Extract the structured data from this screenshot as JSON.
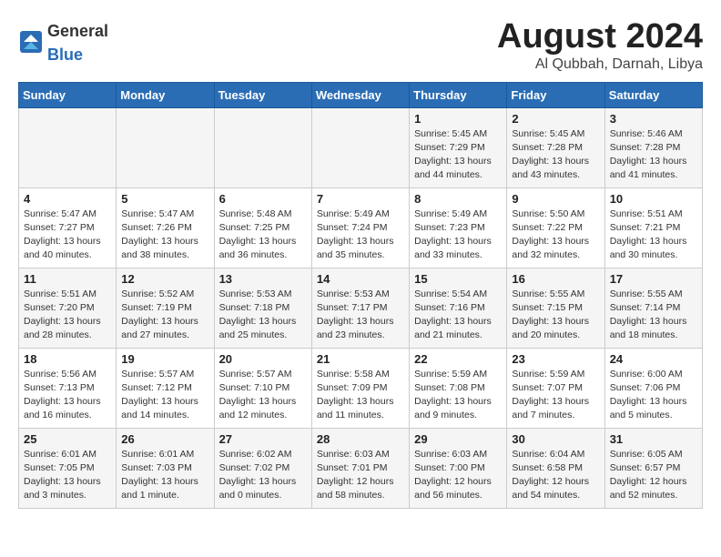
{
  "header": {
    "logo_general": "General",
    "logo_blue": "Blue",
    "month_year": "August 2024",
    "location": "Al Qubbah, Darnah, Libya"
  },
  "days_of_week": [
    "Sunday",
    "Monday",
    "Tuesday",
    "Wednesday",
    "Thursday",
    "Friday",
    "Saturday"
  ],
  "weeks": [
    [
      {
        "day": "",
        "info": ""
      },
      {
        "day": "",
        "info": ""
      },
      {
        "day": "",
        "info": ""
      },
      {
        "day": "",
        "info": ""
      },
      {
        "day": "1",
        "info": "Sunrise: 5:45 AM\nSunset: 7:29 PM\nDaylight: 13 hours\nand 44 minutes."
      },
      {
        "day": "2",
        "info": "Sunrise: 5:45 AM\nSunset: 7:28 PM\nDaylight: 13 hours\nand 43 minutes."
      },
      {
        "day": "3",
        "info": "Sunrise: 5:46 AM\nSunset: 7:28 PM\nDaylight: 13 hours\nand 41 minutes."
      }
    ],
    [
      {
        "day": "4",
        "info": "Sunrise: 5:47 AM\nSunset: 7:27 PM\nDaylight: 13 hours\nand 40 minutes."
      },
      {
        "day": "5",
        "info": "Sunrise: 5:47 AM\nSunset: 7:26 PM\nDaylight: 13 hours\nand 38 minutes."
      },
      {
        "day": "6",
        "info": "Sunrise: 5:48 AM\nSunset: 7:25 PM\nDaylight: 13 hours\nand 36 minutes."
      },
      {
        "day": "7",
        "info": "Sunrise: 5:49 AM\nSunset: 7:24 PM\nDaylight: 13 hours\nand 35 minutes."
      },
      {
        "day": "8",
        "info": "Sunrise: 5:49 AM\nSunset: 7:23 PM\nDaylight: 13 hours\nand 33 minutes."
      },
      {
        "day": "9",
        "info": "Sunrise: 5:50 AM\nSunset: 7:22 PM\nDaylight: 13 hours\nand 32 minutes."
      },
      {
        "day": "10",
        "info": "Sunrise: 5:51 AM\nSunset: 7:21 PM\nDaylight: 13 hours\nand 30 minutes."
      }
    ],
    [
      {
        "day": "11",
        "info": "Sunrise: 5:51 AM\nSunset: 7:20 PM\nDaylight: 13 hours\nand 28 minutes."
      },
      {
        "day": "12",
        "info": "Sunrise: 5:52 AM\nSunset: 7:19 PM\nDaylight: 13 hours\nand 27 minutes."
      },
      {
        "day": "13",
        "info": "Sunrise: 5:53 AM\nSunset: 7:18 PM\nDaylight: 13 hours\nand 25 minutes."
      },
      {
        "day": "14",
        "info": "Sunrise: 5:53 AM\nSunset: 7:17 PM\nDaylight: 13 hours\nand 23 minutes."
      },
      {
        "day": "15",
        "info": "Sunrise: 5:54 AM\nSunset: 7:16 PM\nDaylight: 13 hours\nand 21 minutes."
      },
      {
        "day": "16",
        "info": "Sunrise: 5:55 AM\nSunset: 7:15 PM\nDaylight: 13 hours\nand 20 minutes."
      },
      {
        "day": "17",
        "info": "Sunrise: 5:55 AM\nSunset: 7:14 PM\nDaylight: 13 hours\nand 18 minutes."
      }
    ],
    [
      {
        "day": "18",
        "info": "Sunrise: 5:56 AM\nSunset: 7:13 PM\nDaylight: 13 hours\nand 16 minutes."
      },
      {
        "day": "19",
        "info": "Sunrise: 5:57 AM\nSunset: 7:12 PM\nDaylight: 13 hours\nand 14 minutes."
      },
      {
        "day": "20",
        "info": "Sunrise: 5:57 AM\nSunset: 7:10 PM\nDaylight: 13 hours\nand 12 minutes."
      },
      {
        "day": "21",
        "info": "Sunrise: 5:58 AM\nSunset: 7:09 PM\nDaylight: 13 hours\nand 11 minutes."
      },
      {
        "day": "22",
        "info": "Sunrise: 5:59 AM\nSunset: 7:08 PM\nDaylight: 13 hours\nand 9 minutes."
      },
      {
        "day": "23",
        "info": "Sunrise: 5:59 AM\nSunset: 7:07 PM\nDaylight: 13 hours\nand 7 minutes."
      },
      {
        "day": "24",
        "info": "Sunrise: 6:00 AM\nSunset: 7:06 PM\nDaylight: 13 hours\nand 5 minutes."
      }
    ],
    [
      {
        "day": "25",
        "info": "Sunrise: 6:01 AM\nSunset: 7:05 PM\nDaylight: 13 hours\nand 3 minutes."
      },
      {
        "day": "26",
        "info": "Sunrise: 6:01 AM\nSunset: 7:03 PM\nDaylight: 13 hours\nand 1 minute."
      },
      {
        "day": "27",
        "info": "Sunrise: 6:02 AM\nSunset: 7:02 PM\nDaylight: 13 hours\nand 0 minutes."
      },
      {
        "day": "28",
        "info": "Sunrise: 6:03 AM\nSunset: 7:01 PM\nDaylight: 12 hours\nand 58 minutes."
      },
      {
        "day": "29",
        "info": "Sunrise: 6:03 AM\nSunset: 7:00 PM\nDaylight: 12 hours\nand 56 minutes."
      },
      {
        "day": "30",
        "info": "Sunrise: 6:04 AM\nSunset: 6:58 PM\nDaylight: 12 hours\nand 54 minutes."
      },
      {
        "day": "31",
        "info": "Sunrise: 6:05 AM\nSunset: 6:57 PM\nDaylight: 12 hours\nand 52 minutes."
      }
    ]
  ]
}
